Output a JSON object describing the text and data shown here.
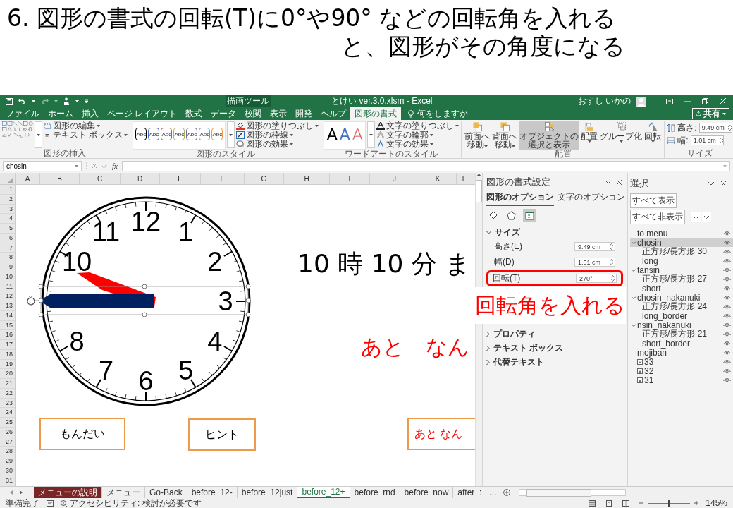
{
  "slide": {
    "lines": [
      "6. 図形の書式の回転(T)に0°や90° などの回転角を入れる",
      "と、図形がその角度になる"
    ]
  },
  "window": {
    "contextual_group": "描画ツール",
    "title": "とけい ver.3.0.xlsm - Excel",
    "user": "おすし いかの"
  },
  "menu_tabs": [
    {
      "label": "ファイル",
      "selected": false
    },
    {
      "label": "ホーム",
      "selected": false
    },
    {
      "label": "挿入",
      "selected": false
    },
    {
      "label": "ページ レイアウト",
      "selected": false
    },
    {
      "label": "数式",
      "selected": false
    },
    {
      "label": "データ",
      "selected": false
    },
    {
      "label": "校閲",
      "selected": false
    },
    {
      "label": "表示",
      "selected": false
    },
    {
      "label": "開発",
      "selected": false
    },
    {
      "label": "ヘルプ",
      "selected": false
    },
    {
      "label": "図形の書式",
      "selected": true
    }
  ],
  "tell_me": "何をしますか",
  "share_button": "共有",
  "ribbon": {
    "insert_shapes": {
      "commands": [
        "図形の編集",
        "テキスト ボックス"
      ],
      "label": "図形の挿入"
    },
    "shape_styles": {
      "presets": [
        {
          "text": "Abc",
          "color": "#000000"
        },
        {
          "text": "Abc",
          "color": "#4472c4"
        },
        {
          "text": "Abc",
          "color": "#c0504d"
        },
        {
          "text": "Abc",
          "color": "#9bbb59"
        },
        {
          "text": "Abc",
          "color": "#8064a2"
        },
        {
          "text": "Abc",
          "color": "#4bacc6"
        },
        {
          "text": "Abc",
          "color": "#f79646"
        }
      ],
      "commands": [
        "図形の塗りつぶし",
        "図形の枠線",
        "図形の効果"
      ],
      "label": "図形のスタイル"
    },
    "wordart": {
      "presets": [
        {
          "text": "A",
          "color": "#000000",
          "kind": "fill"
        },
        {
          "text": "A",
          "color": "#4472c4",
          "kind": "fill"
        },
        {
          "text": "A",
          "color": "#e05a5a",
          "kind": "outline"
        }
      ],
      "commands": [
        "文字の塗りつぶし",
        "文字の輪郭",
        "文字の効果"
      ],
      "label": "ワードアートのスタイル"
    },
    "arrange": {
      "buttons": [
        {
          "lines": [
            "前面へ",
            "移動"
          ],
          "kind": "forward",
          "selected": false
        },
        {
          "lines": [
            "背面へ",
            "移動"
          ],
          "kind": "backward",
          "selected": false
        },
        {
          "lines": [
            "オブジェクトの",
            "選択と表示"
          ],
          "kind": "selection",
          "selected": true
        },
        {
          "lines": [
            "配置"
          ],
          "kind": "align",
          "selected": false
        },
        {
          "lines": [
            "グループ化"
          ],
          "kind": "group",
          "selected": false
        },
        {
          "lines": [
            "回転"
          ],
          "kind": "rotate",
          "selected": false
        }
      ],
      "label": "配置"
    },
    "size": {
      "fields": [
        {
          "label": "高さ:",
          "value": "9.49 cm",
          "kind": "height"
        },
        {
          "label": "幅:",
          "value": "1.01 cm",
          "kind": "width"
        }
      ],
      "label": "サイズ"
    }
  },
  "formula_bar": {
    "name_box": "chosin",
    "function_label": "fx"
  },
  "sheet": {
    "columns": [
      "A",
      "B",
      "C",
      "D",
      "E",
      "F",
      "G",
      "H",
      "I",
      "J",
      "K",
      "L"
    ],
    "rows": [
      "1",
      "2",
      "3",
      "4",
      "5",
      "6",
      "7",
      "8",
      "9",
      "10",
      "11",
      "12",
      "13",
      "14",
      "15",
      "16",
      "17",
      "18",
      "19",
      "20",
      "21",
      "22",
      "23",
      "24",
      "25",
      "26",
      "27",
      "28",
      "29",
      "30",
      "31"
    ],
    "clock_numerals": [
      "11",
      "12",
      "1",
      "10",
      "2",
      "3",
      "8",
      "4",
      "7",
      "5",
      "6"
    ],
    "texts": [
      {
        "text": "10 時 10 分 ま",
        "color": "#000000"
      },
      {
        "text": "あと　なん",
        "color": "#ff0000"
      }
    ],
    "buttons": [
      {
        "label": "もんだい",
        "color": "#000000"
      },
      {
        "label": "ヒント",
        "color": "#000000"
      },
      {
        "label": "あと なん",
        "color": "#ff0000"
      }
    ]
  },
  "format_pane": {
    "title": "図形の書式設定",
    "tabs": [
      {
        "label": "図形のオプション",
        "selected": true
      },
      {
        "label": "文字のオプション",
        "selected": false
      }
    ],
    "icons": [
      {
        "kind": "fill",
        "selected": false
      },
      {
        "kind": "effects",
        "selected": false
      },
      {
        "kind": "size",
        "selected": true
      }
    ],
    "sections": [
      {
        "label": "サイズ",
        "expanded": true,
        "fields": [
          {
            "label": "高さ(E)",
            "value": "9.49 cm",
            "highlighted": false
          },
          {
            "label": "幅(D)",
            "value": "1.01 cm",
            "highlighted": false
          },
          {
            "label": "回転(T)",
            "value": "270°",
            "highlighted": true
          }
        ]
      },
      {
        "label": "プロパティ",
        "expanded": false
      },
      {
        "label": "テキスト ボックス",
        "expanded": false
      },
      {
        "label": "代替テキスト",
        "expanded": false
      }
    ]
  },
  "selection_pane": {
    "title": "選択",
    "buttons": [
      "すべて表示",
      "すべて非表示"
    ],
    "items": [
      {
        "label": "to menu",
        "kind": "shape",
        "selected": false
      },
      {
        "label": "chosin",
        "kind": "shape",
        "selected": true,
        "expanded": true,
        "children": [
          {
            "label": "正方形/長方形 30",
            "selected": false
          },
          {
            "label": "long",
            "selected": false
          }
        ]
      },
      {
        "label": "tansin",
        "kind": "shape",
        "selected": false,
        "expanded": true,
        "children": [
          {
            "label": "正方形/長方形 27",
            "selected": false
          },
          {
            "label": "short",
            "selected": false
          }
        ]
      },
      {
        "label": "chosin_nakanuki",
        "kind": "shape",
        "selected": false,
        "expanded": true,
        "children": [
          {
            "label": "正方形/長方形 24",
            "selected": false
          },
          {
            "label": "long_border",
            "selected": false
          }
        ]
      },
      {
        "label": "nsin_nakanuki",
        "kind": "shape",
        "selected": false,
        "expanded": true,
        "children": [
          {
            "label": "正方形/長方形 21",
            "selected": false
          },
          {
            "label": "short_border",
            "selected": false
          }
        ]
      },
      {
        "label": "mojiban",
        "kind": "shape",
        "selected": false
      },
      {
        "label": "33",
        "kind": "picture",
        "selected": false
      },
      {
        "label": "32",
        "kind": "picture",
        "selected": false
      },
      {
        "label": "31",
        "kind": "picture",
        "selected": false
      }
    ]
  },
  "sheet_tabs": [
    {
      "label": "メニューの説明",
      "selected": false,
      "color": "#7b2626"
    },
    {
      "label": "メニュー",
      "selected": false
    },
    {
      "label": "Go-Back",
      "selected": false
    },
    {
      "label": "before_12-",
      "selected": false
    },
    {
      "label": "before_12just",
      "selected": false
    },
    {
      "label": "before_12+",
      "selected": true
    },
    {
      "label": "before_rnd",
      "selected": false
    },
    {
      "label": "before_now",
      "selected": false
    },
    {
      "label": "after_:",
      "selected": false
    }
  ],
  "more_tabs": "...",
  "status_bar": {
    "ready": "準備完了",
    "accessibility": "アクセシビリティ: 検討が必要です",
    "zoom": {
      "level": 0.5,
      "percent": "145%"
    }
  },
  "annotation": {
    "text": "回転角を入れる"
  }
}
